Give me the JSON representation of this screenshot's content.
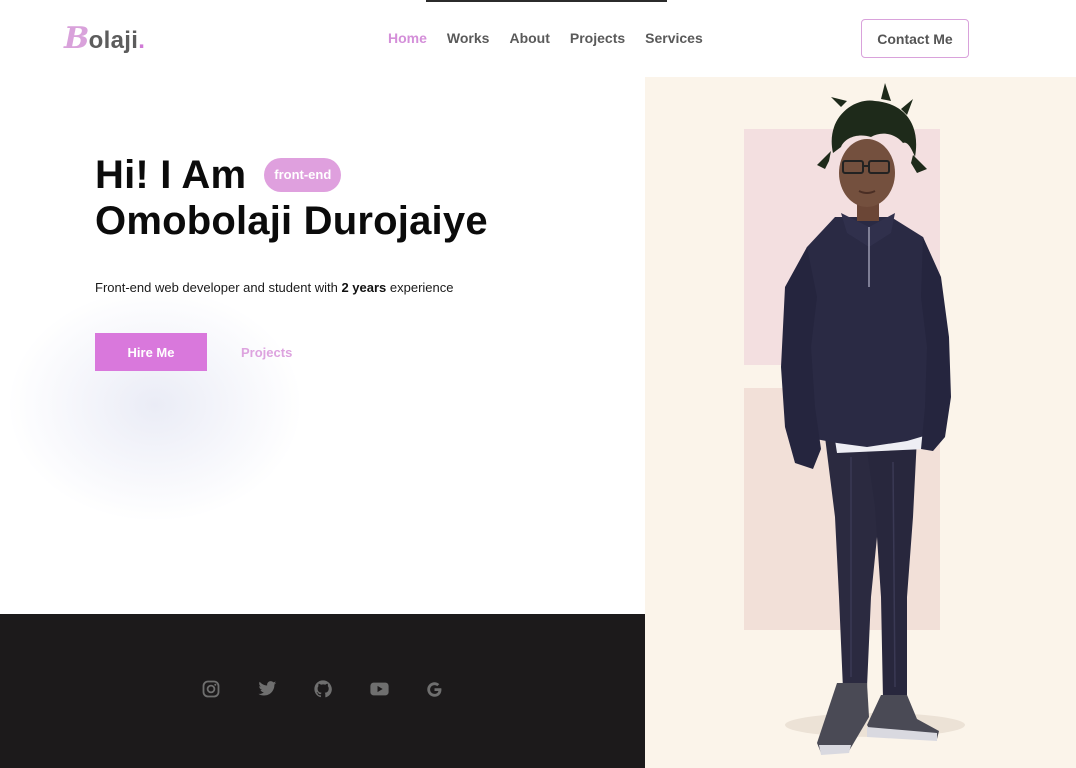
{
  "header": {
    "logo_initial": "B",
    "logo_rest": "olaji",
    "logo_dot": ".",
    "nav": [
      {
        "label": "Home",
        "active": true
      },
      {
        "label": "Works",
        "active": false
      },
      {
        "label": "About",
        "active": false
      },
      {
        "label": "Projects",
        "active": false
      },
      {
        "label": "Services",
        "active": false
      }
    ],
    "contact_label": "Contact Me"
  },
  "hero": {
    "greeting": "Hi! I Am",
    "tag": "front-end",
    "name": "Omobolaji Durojaiye",
    "subtitle_pre": "Front-end web developer and student with ",
    "subtitle_bold": "2 years",
    "subtitle_post": " experience",
    "hire_label": "Hire Me",
    "projects_label": "Projects"
  },
  "social": [
    {
      "icon": "instagram-icon"
    },
    {
      "icon": "twitter-icon"
    },
    {
      "icon": "github-icon"
    },
    {
      "icon": "youtube-icon"
    },
    {
      "icon": "google-icon"
    }
  ],
  "colors": {
    "accent": "#d978dc",
    "accent_light": "#dfa0de",
    "dark_band": "#1c1a1b",
    "art_background": "#fbf4ea",
    "art_block_top": "#f3dfe0",
    "art_block_bottom": "#f2e0d8"
  }
}
